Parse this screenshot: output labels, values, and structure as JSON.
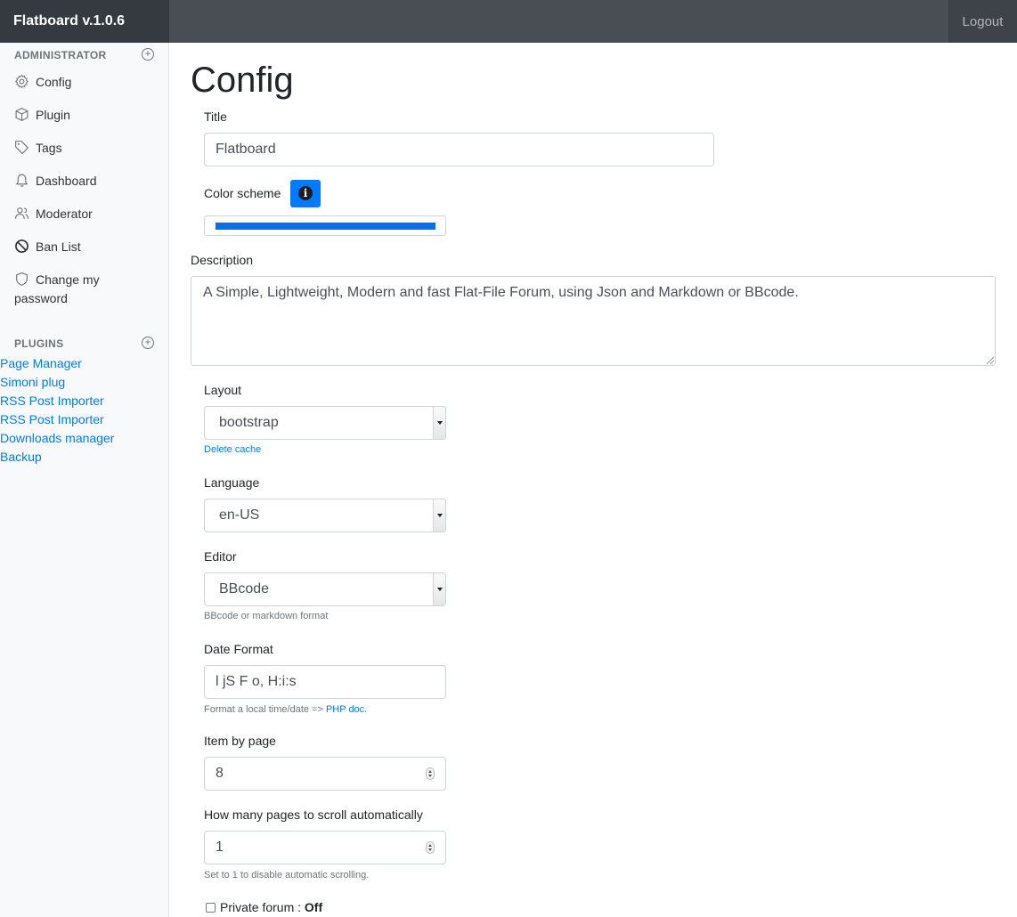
{
  "navbar": {
    "brand": "Flatboard v.1.0.6",
    "logout": "Logout"
  },
  "sidebar": {
    "admin_heading": "ADMINISTRATOR",
    "items": [
      {
        "label": "Config",
        "icon": "gear-icon"
      },
      {
        "label": "Plugin",
        "icon": "box-icon"
      },
      {
        "label": "Tags",
        "icon": "tag-icon"
      },
      {
        "label": "Dashboard",
        "icon": "bell-icon"
      },
      {
        "label": "Moderator",
        "icon": "users-icon"
      },
      {
        "label": "Ban List",
        "icon": "ban-icon"
      },
      {
        "label": "Change my",
        "label2": "password",
        "icon": "shield-icon"
      }
    ],
    "plugins_heading": "PLUGINS",
    "plugins": [
      "Page Manager",
      "Simoni plug",
      "RSS Post Importer",
      "RSS Post Importer",
      "Downloads manager",
      "Backup"
    ]
  },
  "page": {
    "title": "Config"
  },
  "form": {
    "title_label": "Title",
    "title_value": "Flatboard",
    "color_label": "Color scheme",
    "color_value": "#0d6ee0",
    "description_label": "Description",
    "description_value": "A Simple, Lightweight, Modern and fast Flat-File Forum, using Json and Markdown or BBcode.",
    "layout_label": "Layout",
    "layout_value": "bootstrap",
    "delete_cache": "Delete cache",
    "language_label": "Language",
    "language_value": "en-US",
    "editor_label": "Editor",
    "editor_value": "BBcode",
    "editor_help": "BBcode or markdown format",
    "date_label": "Date Format",
    "date_value": "l jS F o, H:i:s",
    "date_help": "Format a local time/date =>",
    "date_help_link": "PHP doc.",
    "items_label": "Item by page",
    "items_value": "8",
    "scroll_label": "How many pages to scroll automatically",
    "scroll_value": "1",
    "scroll_help": "Set to 1 to disable automatic scrolling.",
    "private_label": "Private forum : ",
    "private_state": "Off"
  }
}
